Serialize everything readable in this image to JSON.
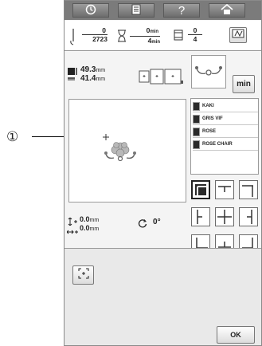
{
  "callout": {
    "marker": "①"
  },
  "topbar": {
    "icons": [
      "clock-icon",
      "document-icon",
      "help-icon",
      "home-icon"
    ],
    "help_label": "?"
  },
  "counters": {
    "stitch_current": "0",
    "stitch_total": "2723",
    "time_current": "0",
    "time_current_unit": "min",
    "time_total": "4",
    "time_total_unit": "min",
    "color_current": "0",
    "color_total": "4"
  },
  "size": {
    "width_value": "41.4",
    "width_unit": "mm",
    "height_value": "49.3",
    "height_unit": "mm"
  },
  "min_button": {
    "label": "min"
  },
  "threads": [
    {
      "name": "KAKI",
      "color": "#3a3a3a"
    },
    {
      "name": "GRIS VIF",
      "color": "#3a3a3a"
    },
    {
      "name": "ROSE",
      "color": "#3a3a3a"
    },
    {
      "name": "ROSE CHAIR",
      "color": "#3a3a3a"
    }
  ],
  "position": {
    "vertical_value": "0.0",
    "vertical_unit": "mm",
    "horizontal_value": "0.0",
    "horizontal_unit": "mm",
    "rotation_value": "0",
    "rotation_unit": "°"
  },
  "ok_button": {
    "label": "OK"
  },
  "colors": {
    "bar": "#7b7b7b",
    "panel": "#f4f4f4",
    "accent": "#222222"
  }
}
